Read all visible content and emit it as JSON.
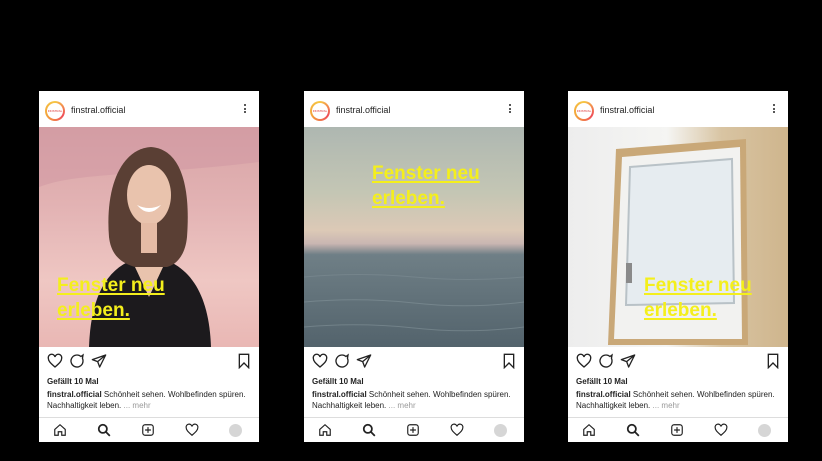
{
  "posts": [
    {
      "username": "finstral.official",
      "avatar_text": "FINSTRAL",
      "headline_line1": "Fenster neu",
      "headline_line2": "erleben.",
      "likes": "Gefällt 10 Mal",
      "caption_user": "finstral.official",
      "caption_text": "Schönheit sehen. Wohlbefinden spüren. Nachhaltigkeit leben.",
      "more": "... mehr",
      "image": "woman-laughing-pink-sky"
    },
    {
      "username": "finstral.official",
      "avatar_text": "FINSTRAL",
      "headline_line1": "Fenster neu",
      "headline_line2": "erleben.",
      "likes": "Gefällt 10 Mal",
      "caption_user": "finstral.official",
      "caption_text": "Schönheit sehen. Wohlbefinden spüren. Nachhaltigkeit leben.",
      "more": "... mehr",
      "image": "sea-horizon-dusk"
    },
    {
      "username": "finstral.official",
      "avatar_text": "FINSTRAL",
      "headline_line1": "Fenster neu",
      "headline_line2": "erleben.",
      "likes": "Gefällt 10 Mal",
      "caption_user": "finstral.official",
      "caption_text": "Schönheit sehen. Wohlbefinden spüren. Nachhaltigkeit leben.",
      "more": "... mehr",
      "image": "window-frame-leaning-on-wall"
    }
  ],
  "icons": {
    "actions": [
      "heart-icon",
      "comment-icon",
      "share-icon",
      "bookmark-icon"
    ],
    "nav": [
      "home-icon",
      "search-icon",
      "add-post-icon",
      "activity-heart-icon",
      "profile-avatar"
    ]
  },
  "colors": {
    "headline": "#f4ef1c",
    "background": "#000000"
  }
}
